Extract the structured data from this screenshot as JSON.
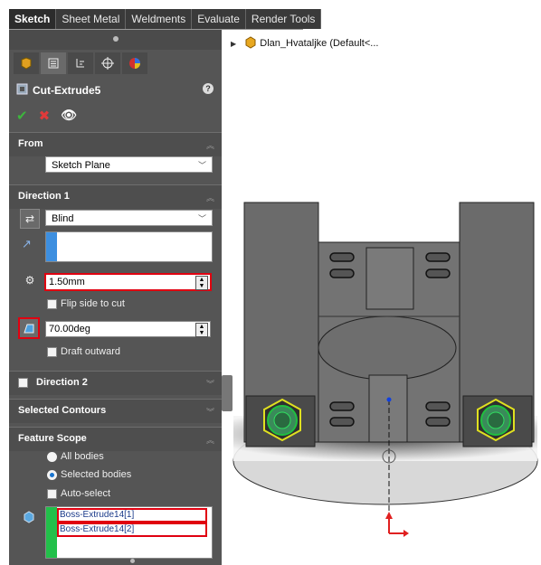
{
  "ribbon": {
    "tabs": [
      "Sketch",
      "Sheet Metal",
      "Weldments",
      "Evaluate",
      "Render Tools"
    ],
    "active": "Sketch"
  },
  "property_manager": {
    "title": "Cut-Extrude5",
    "help": "?",
    "from": {
      "header": "From",
      "value": "Sketch Plane"
    },
    "direction1": {
      "header": "Direction 1",
      "end_condition": "Blind",
      "depth": "1.50mm",
      "flip_side": "Flip side to cut",
      "draft_angle": "70.00deg",
      "draft_outward": "Draft outward"
    },
    "direction2": {
      "header": "Direction 2"
    },
    "selected_contours": {
      "header": "Selected Contours"
    },
    "feature_scope": {
      "header": "Feature Scope",
      "all_bodies": "All bodies",
      "selected_bodies": "Selected bodies",
      "auto_select": "Auto-select",
      "bodies": [
        "Boss-Extrude14[1]",
        "Boss-Extrude14[2]"
      ]
    }
  },
  "tree": {
    "root": "Dlan_Hvataljke  (Default<..."
  },
  "colors": {
    "panel_bg": "#555555",
    "highlight_red": "#e00010",
    "selected_green": "#22c04a"
  }
}
